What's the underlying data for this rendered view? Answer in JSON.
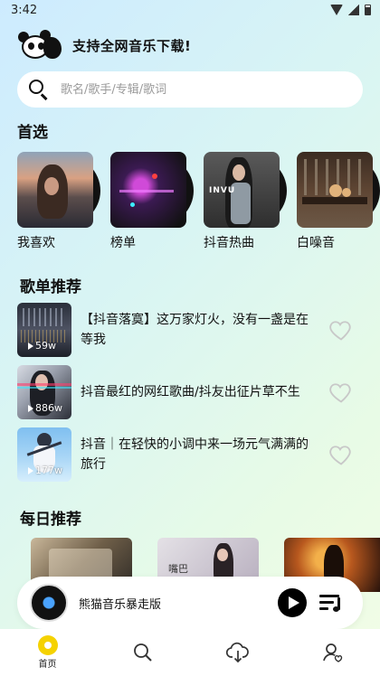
{
  "status_bar": {
    "time": "3:42"
  },
  "header": {
    "title": "支持全网音乐下载!"
  },
  "search": {
    "placeholder": "歌名/歌手/专辑/歌词"
  },
  "featured": {
    "title": "首选",
    "items": [
      {
        "label": "我喜欢"
      },
      {
        "label": "榜单"
      },
      {
        "label": "抖音热曲",
        "cover_text": "INVU"
      },
      {
        "label": "白噪音"
      }
    ]
  },
  "playlists": {
    "title": "歌单推荐",
    "items": [
      {
        "title": "【抖音落寞】这万家灯火，没有一盏是在等我",
        "plays": "59w"
      },
      {
        "title": "抖音最红的网红歌曲/抖友出征片草不生",
        "plays": "886w"
      },
      {
        "title": "抖音｜在轻快的小调中来一场元气满满的旅行",
        "plays": "177w"
      }
    ]
  },
  "daily": {
    "title": "每日推荐",
    "card2_text": "嘴巴"
  },
  "player": {
    "title": "熊猫音乐暴走版"
  },
  "nav": {
    "items": [
      {
        "label": "首页",
        "icon": "home-icon"
      },
      {
        "label": "",
        "icon": "search-icon"
      },
      {
        "label": "",
        "icon": "download-icon"
      },
      {
        "label": "",
        "icon": "profile-icon"
      }
    ]
  },
  "colors": {
    "accent": "#f5d200",
    "background_start": "#cdebff",
    "background_end": "#f2fde6"
  }
}
